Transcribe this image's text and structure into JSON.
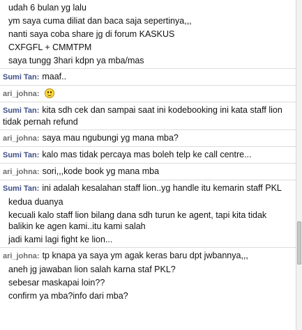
{
  "messages": [
    {
      "sender": "",
      "lines": [
        "udah 6 bulan yg lalu",
        "ym saya cuma diliat dan baca saja sepertinya,,,",
        "nanti saya coba share jg di forum KASKUS",
        "CXFGFL + CMMTPM",
        "saya tungg 3hari kdpn ya mba/mas"
      ]
    },
    {
      "sender": "Sumi Tan:",
      "lines": [
        "maaf.."
      ]
    },
    {
      "sender": "ari_johna:",
      "lines": [
        ""
      ],
      "emoticon": "smiley-face"
    },
    {
      "sender": "Sumi Tan:",
      "lines": [
        "kita sdh cek dan sampai saat ini kodebooking ini kata staff lion tidak pernah refund"
      ]
    },
    {
      "sender": "ari_johna:",
      "lines": [
        "saya mau ngubungi yg mana mba?"
      ]
    },
    {
      "sender": "Sumi Tan:",
      "lines": [
        "kalo mas tidak percaya mas boleh telp ke call centre..."
      ]
    },
    {
      "sender": "ari_johna:",
      "lines": [
        "sori,,,kode book yg mana mba"
      ]
    },
    {
      "sender": "Sumi Tan:",
      "lines": [
        "ini adalah kesalahan staff lion..yg handle itu kemarin staff PKL",
        "kedua duanya",
        "kecuali kalo staff lion bilang dana sdh turun ke agent, tapi kita tidak balikin ke agen kami..itu kami salah",
        "jadi kami lagi fight ke lion..."
      ]
    },
    {
      "sender": "ari_johna:",
      "lines": [
        "tp knapa ya saya ym agak keras baru dpt jwbannya,,,",
        "aneh jg jawaban lion salah karna staf PKL?",
        "sebesar maskapai loin??",
        "confirm ya mba?info dari mba?"
      ]
    }
  ]
}
